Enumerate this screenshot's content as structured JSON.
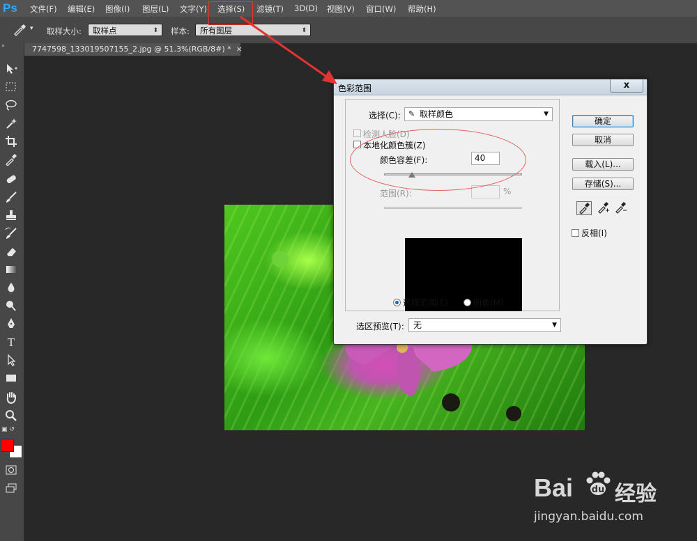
{
  "app": {
    "logo": "Ps"
  },
  "menu": [
    "文件(F)",
    "编辑(E)",
    "图像(I)",
    "图层(L)",
    "文字(Y)",
    "选择(S)",
    "滤镜(T)",
    "3D(D)",
    "视图(V)",
    "窗口(W)",
    "帮助(H)"
  ],
  "options": {
    "sample_size_label": "取样大小:",
    "sample_size_value": "取样点",
    "sample_label": "样本:",
    "sample_value": "所有图层"
  },
  "document": {
    "tab_label": "7747598_133019507155_2.jpg @ 51.3%(RGB/8#) *",
    "close_glyph": "×"
  },
  "dialog": {
    "title": "色彩范围",
    "close_glyph": "x",
    "select_label": "选择(C):",
    "select_value": "取样颜色",
    "detect_faces_label": "检测人脸(D)",
    "localized_label": "本地化颜色簇(Z)",
    "fuzziness_label": "颜色容差(F):",
    "fuzziness_value": "40",
    "fuzziness_level": 0.2,
    "range_label": "范围(R):",
    "range_unit": "%",
    "radio_selection_label": "选择范围(E)",
    "radio_image_label": "图像(M)",
    "preview_label": "选区预览(T):",
    "preview_value": "无",
    "ok_label": "确定",
    "cancel_label": "取消",
    "load_label": "载入(L)...",
    "save_label": "存储(S)...",
    "invert_label": "反相(I)"
  },
  "colors": {
    "foreground": "#ff0000",
    "background": "#ffffff",
    "annotation": "#e33333"
  },
  "watermark": {
    "brand": "Bai",
    "brand2": "经验",
    "url": "jingyan.baidu.com"
  }
}
